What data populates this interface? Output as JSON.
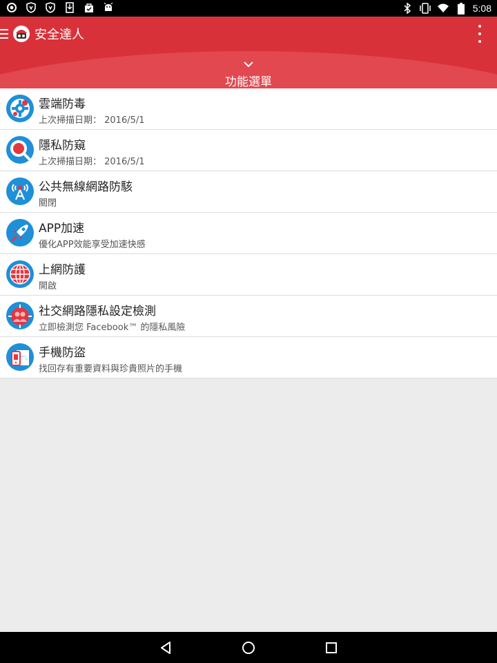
{
  "status_bar": {
    "time": "5:08",
    "left_icons": [
      "record-icon",
      "shield-icon",
      "shield-icon",
      "download-icon",
      "shopping-bag-icon",
      "android-icon"
    ],
    "right_icons": [
      "bluetooth-icon",
      "vibrate-icon",
      "wifi-icon",
      "battery-icon"
    ]
  },
  "app_bar": {
    "title": "安全達人",
    "menu_icon": "hamburger-icon",
    "overflow_icon": "more-vert-icon",
    "feature_menu_label": "功能選單",
    "accent_color": "#d9313a"
  },
  "menu_items": [
    {
      "title": "雲端防毒",
      "subtitle": "上次掃描日期： 2016/5/1",
      "icon": "cloud-antivirus-icon"
    },
    {
      "title": "隱私防窺",
      "subtitle": "上次掃描日期： 2016/5/1",
      "icon": "privacy-scan-icon"
    },
    {
      "title": "公共無線網路防駭",
      "subtitle": "關閉",
      "icon": "wifi-protect-icon"
    },
    {
      "title": "APP加速",
      "subtitle": "優化APP效能享受加速快感",
      "icon": "rocket-icon"
    },
    {
      "title": "上網防護",
      "subtitle": "開啟",
      "icon": "globe-icon"
    },
    {
      "title": "社交網路隱私設定檢測",
      "subtitle": "立即檢測您 Facebook™ 的隱私風險",
      "icon": "social-privacy-icon"
    },
    {
      "title": "手機防盜",
      "subtitle": "找回存有重要資料與珍貴照片的手機",
      "icon": "phone-locate-icon"
    }
  ],
  "nav_bar": {
    "buttons": [
      "back-icon",
      "home-icon",
      "recents-icon"
    ]
  }
}
